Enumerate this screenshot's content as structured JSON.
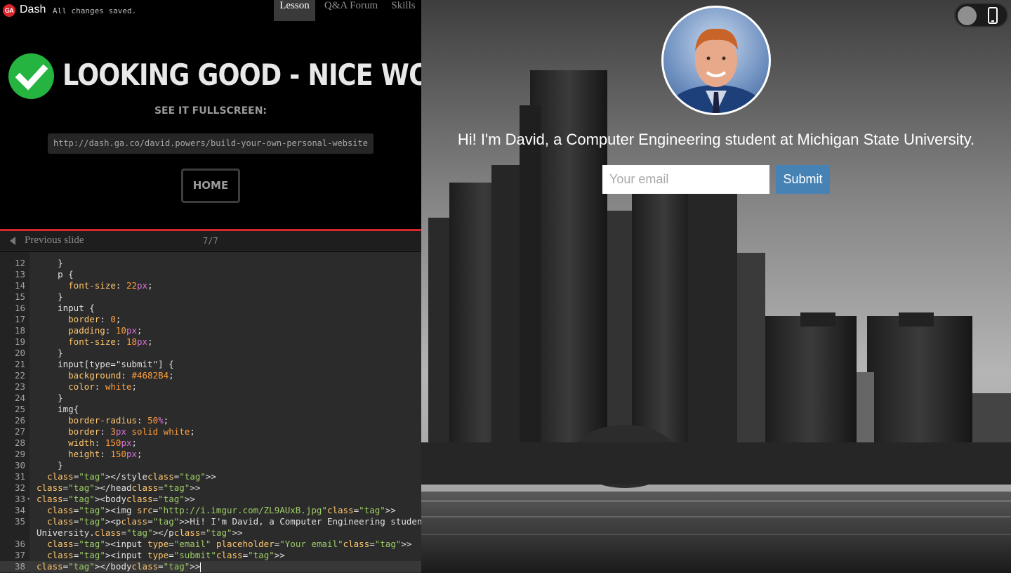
{
  "topbar": {
    "logo_text": "GA",
    "app_name": "Dash",
    "save_status": "All changes saved.",
    "tabs": [
      {
        "label": "Lesson",
        "active": true
      },
      {
        "label": "Q&A Forum",
        "active": false
      },
      {
        "label": "Skills",
        "active": false
      }
    ]
  },
  "success": {
    "headline": "LOOKING GOOD - NICE WORK!",
    "fullscreen_label": "SEE IT FULLSCREEN:",
    "url": "http://dash.ga.co/david.powers/build-your-own-personal-website",
    "home_button": "HOME"
  },
  "slide_nav": {
    "previous_label": "Previous slide",
    "counter": "7/7"
  },
  "editor": {
    "lines": [
      {
        "n": "12",
        "code": "    }"
      },
      {
        "n": "13",
        "code": "    p {"
      },
      {
        "n": "14",
        "code": "      font-size: 22px;"
      },
      {
        "n": "15",
        "code": "    }"
      },
      {
        "n": "16",
        "code": "    input {"
      },
      {
        "n": "17",
        "code": "      border: 0;"
      },
      {
        "n": "18",
        "code": "      padding: 10px;"
      },
      {
        "n": "19",
        "code": "      font-size: 18px;"
      },
      {
        "n": "20",
        "code": "    }"
      },
      {
        "n": "21",
        "code": "    input[type=\"submit\"] {"
      },
      {
        "n": "22",
        "code": "      background: #4682B4;"
      },
      {
        "n": "23",
        "code": "      color: white;"
      },
      {
        "n": "24",
        "code": "    }"
      },
      {
        "n": "25",
        "code": "    img{"
      },
      {
        "n": "26",
        "code": "      border-radius: 50%;"
      },
      {
        "n": "27",
        "code": "      border: 3px solid white;"
      },
      {
        "n": "28",
        "code": "      width: 150px;"
      },
      {
        "n": "29",
        "code": "      height: 150px;"
      },
      {
        "n": "30",
        "code": "    }"
      },
      {
        "n": "31",
        "code": "  </style>"
      },
      {
        "n": "32",
        "code": "</head>"
      },
      {
        "n": "33",
        "code": "<body>"
      },
      {
        "n": "34",
        "code": "  <img src=\"http://i.imgur.com/ZL9AUxB.jpg\">"
      },
      {
        "n": "35",
        "code": "  <p>Hi! I'm David, a Computer Engineering student at Michigan State"
      },
      {
        "n": "",
        "code": "University.</p>"
      },
      {
        "n": "36",
        "code": "  <input type=\"email\" placeholder=\"Your email\">"
      },
      {
        "n": "37",
        "code": "  <input type=\"submit\">"
      },
      {
        "n": "38",
        "code": "</body>"
      }
    ]
  },
  "preview": {
    "intro_text": "Hi! I'm David, a Computer Engineering student at Michigan State University.",
    "email_placeholder": "Your email",
    "submit_label": "Submit",
    "accent_color": "#4682b4"
  },
  "colors": {
    "brand_red": "#d9262b",
    "success_green": "#25b43f"
  }
}
